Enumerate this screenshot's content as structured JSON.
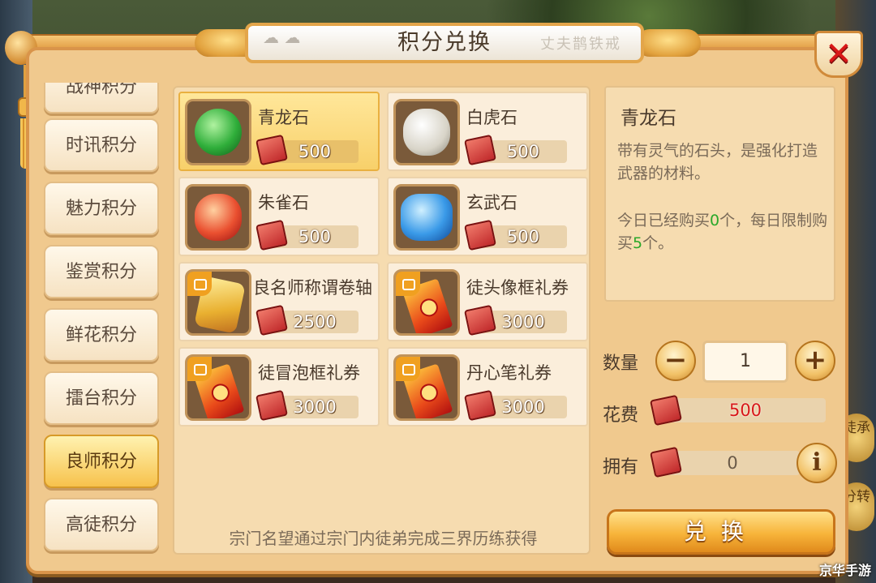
{
  "title": "积分兑换",
  "title_ink": "丈夫鹊铁戒",
  "close_label": "✕",
  "tabs": [
    {
      "label": "战神积分",
      "active": false
    },
    {
      "label": "时讯积分",
      "active": false
    },
    {
      "label": "魅力积分",
      "active": false
    },
    {
      "label": "鉴赏积分",
      "active": false
    },
    {
      "label": "鲜花积分",
      "active": false
    },
    {
      "label": "擂台积分",
      "active": false
    },
    {
      "label": "良师积分",
      "active": true
    },
    {
      "label": "高徒积分",
      "active": false
    }
  ],
  "items": [
    {
      "name": "青龙石",
      "price": "500",
      "icon": "green-dragon-stone",
      "selected": true
    },
    {
      "name": "白虎石",
      "price": "500",
      "icon": "white-tiger-stone",
      "selected": false
    },
    {
      "name": "朱雀石",
      "price": "500",
      "icon": "vermilion-bird-stone",
      "selected": false
    },
    {
      "name": "玄武石",
      "price": "500",
      "icon": "black-tortoise-stone",
      "selected": false
    },
    {
      "name": "良名师称谓卷轴",
      "price": "2500",
      "icon": "title-scroll",
      "selected": false
    },
    {
      "name": "徒头像框礼券",
      "price": "3000",
      "icon": "coupon",
      "selected": false
    },
    {
      "name": "徒冒泡框礼券",
      "price": "3000",
      "icon": "coupon",
      "selected": false
    },
    {
      "name": "丹心笔礼券",
      "price": "3000",
      "icon": "coupon",
      "selected": false
    }
  ],
  "grid_footer": "宗门名望通过宗门内徒弟完成三界历练获得",
  "detail": {
    "name": "青龙石",
    "description": "带有灵气的石头，是强化打造武器的材料。",
    "limit_prefix": "今日已经购买",
    "bought": "0",
    "limit_mid": "个，每日限制购买",
    "limit_max": "5",
    "limit_suffix": "个。"
  },
  "quantity": {
    "label": "数量",
    "value": "1",
    "minus": "−",
    "plus": "+"
  },
  "cost": {
    "label": "花费",
    "value": "500"
  },
  "owned": {
    "label": "拥有",
    "value": "0",
    "info": "i"
  },
  "exchange_label": "兑换",
  "side_buttons": [
    "徒承",
    "分转"
  ],
  "watermark": "京华手游",
  "colors": {
    "accent": "#f7b43a",
    "cost_red": "#d81818",
    "limit_green": "#2aa82a"
  }
}
